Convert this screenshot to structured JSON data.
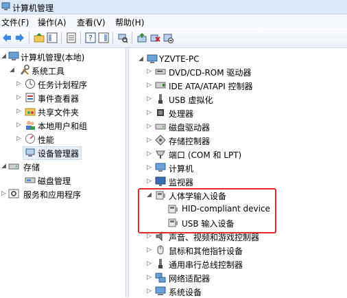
{
  "window": {
    "title": "计算机管理"
  },
  "menu": [
    {
      "label": "文件(F)"
    },
    {
      "label": "操作(A)"
    },
    {
      "label": "查看(V)"
    },
    {
      "label": "帮助(H)"
    }
  ],
  "left_tree": {
    "root": "计算机管理(本地)",
    "system_tools": "系统工具",
    "items": [
      "任务计划程序",
      "事件查看器",
      "共享文件夹",
      "本地用户和组",
      "性能",
      "设备管理器"
    ],
    "storage": "存储",
    "disk_management": "磁盘管理",
    "services": "服务和应用程序"
  },
  "device_tree": {
    "root": "YZVTE-PC",
    "categories": [
      "DVD/CD-ROM 驱动器",
      "IDE ATA/ATAPI 控制器",
      "USB 虚拟化",
      "处理器",
      "磁盘驱动器",
      "存储控制器",
      "端口 (COM 和 LPT)",
      "计算机",
      "监视器",
      "人体学输入设备",
      "声音、视频和游戏控制器",
      "鼠标和其他指针设备",
      "通用串行总线控制器",
      "网络适配器",
      "系统设备"
    ],
    "hid_children": [
      "HID-compliant device",
      "USB 输入设备"
    ]
  },
  "colors": {
    "highlight": "#e8272a",
    "title_bg": "#dce8f5"
  }
}
